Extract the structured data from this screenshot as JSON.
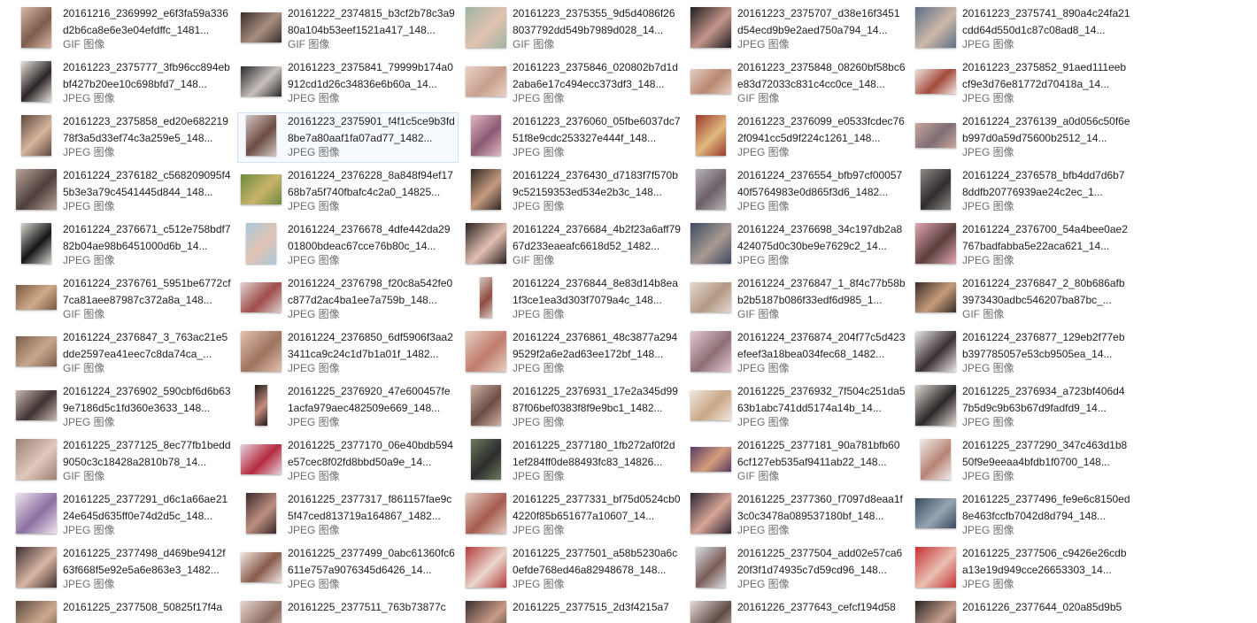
{
  "window": {
    "title": ""
  },
  "items": [
    {
      "name": "20161216_2369992_e6f3fa59a336d2b6ca8e6e3e04efdffc_1481...",
      "type": "GIF 图像",
      "thumb": {
        "colors": [
          "#d9b8a6",
          "#7c5b4c"
        ],
        "shape": "portrait"
      }
    },
    {
      "name": "20161222_2374815_b3cf2b78c3a980a104b53eef1521a417_148...",
      "type": "GIF 图像",
      "thumb": {
        "colors": [
          "#3b302c",
          "#a88e80"
        ],
        "shape": "landscape"
      }
    },
    {
      "name": "20161223_2375355_9d5d4086f268037792dd549b7989d028_14...",
      "type": "GIF 图像",
      "thumb": {
        "colors": [
          "#9fb3a4",
          "#e2c2b0"
        ],
        "shape": "square"
      }
    },
    {
      "name": "20161223_2375707_d38e16f3451d54ecd9b9e2aed750a794_14...",
      "type": "JPEG 图像",
      "thumb": {
        "colors": [
          "#1f1f1f",
          "#c4948a"
        ],
        "shape": "square"
      }
    },
    {
      "name": "20161223_2375741_890a4c24fa21cdd64d550d1c87c08ad8_14...",
      "type": "JPEG 图像",
      "thumb": {
        "colors": [
          "#5c7089",
          "#cdb7a6"
        ],
        "shape": "square"
      }
    },
    {
      "name": "20161223_2375777_3fb96cc894ebbf427b20ee10c698bfd7_148...",
      "type": "JPEG 图像",
      "thumb": {
        "colors": [
          "#e8e2dc",
          "#2b2626"
        ],
        "shape": "portrait"
      }
    },
    {
      "name": "20161223_2375841_79999b174a0912cd1d26c34836e6b60a_14...",
      "type": "JPEG 图像",
      "thumb": {
        "colors": [
          "#2c2a2c",
          "#c8c1bd"
        ],
        "shape": "landscape"
      }
    },
    {
      "name": "20161223_2375846_020802b7d1d2aba6e17c494ecc373df3_148...",
      "type": "JPEG 图像",
      "thumb": {
        "colors": [
          "#e9d2c6",
          "#c79f8c"
        ],
        "shape": "landscape"
      }
    },
    {
      "name": "20161223_2375848_08260bf58bc6e83d72033c831c4cc0ce_148...",
      "type": "GIF 图像",
      "thumb": {
        "colors": [
          "#e7cfc5",
          "#b7876f"
        ],
        "shape": "wide"
      }
    },
    {
      "name": "20161223_2375852_91aed111eebcf9e3d76e81772d70418a_14...",
      "type": "JPEG 图像",
      "thumb": {
        "colors": [
          "#efe4dc",
          "#a24a3c"
        ],
        "shape": "wide"
      }
    },
    {
      "name": "20161223_2375858_ed20e68221978f3a5d33ef74c3a259e5_148...",
      "type": "JPEG 图像",
      "thumb": {
        "colors": [
          "#5d4b3f",
          "#d6b49c"
        ],
        "shape": "portrait"
      }
    },
    {
      "name": "20161223_2375901_f4f1c5ce9b3fd8be7a80aaf1fa07ad77_1482...",
      "type": "JPEG 图像",
      "thumb": {
        "colors": [
          "#d2c6c2",
          "#6d4d43"
        ],
        "shape": "portrait"
      }
    },
    {
      "name": "20161223_2376060_05fbe6037dc751f8e9cdc253327e444f_148...",
      "type": "JPEG 图像",
      "thumb": {
        "colors": [
          "#e0b7c3",
          "#8b5a73"
        ],
        "shape": "portrait"
      }
    },
    {
      "name": "20161223_2376099_e0533fcdec762f0941cc5d9f224c1261_148...",
      "type": "JPEG 图像",
      "thumb": {
        "colors": [
          "#9b3a2e",
          "#e0b87d"
        ],
        "shape": "portrait"
      }
    },
    {
      "name": "20161224_2376139_a0d056c50f6eb997d0a59d75600b2512_14...",
      "type": "JPEG 图像",
      "thumb": {
        "colors": [
          "#c9a79f",
          "#7f6d73"
        ],
        "shape": "wide"
      }
    },
    {
      "name": "20161224_2376182_c568209095f45b3e3a79c4541445d844_148...",
      "type": "JPEG 图像",
      "thumb": {
        "colors": [
          "#b7a69b",
          "#4d3e3a"
        ],
        "shape": "square"
      }
    },
    {
      "name": "20161224_2376228_8a848f94ef1768b7a5f740fbafc4c2a0_14825...",
      "type": "JPEG 图像",
      "thumb": {
        "colors": [
          "#6d8a3f",
          "#c8b46a"
        ],
        "shape": "landscape"
      }
    },
    {
      "name": "20161224_2376430_d7183f7f570b9c52159353ed534e2b3c_148...",
      "type": "JPEG 图像",
      "thumb": {
        "colors": [
          "#2f2825",
          "#c79b80"
        ],
        "shape": "portrait"
      }
    },
    {
      "name": "20161224_2376554_bfb97cf0005740f5764983e0d865f3d6_1482...",
      "type": "JPEG 图像",
      "thumb": {
        "colors": [
          "#b8b3b8",
          "#6c5f67"
        ],
        "shape": "portrait"
      }
    },
    {
      "name": "20161224_2376578_bfb4dd7d6b78ddfb20776939ae24c2ec_1...",
      "type": "JPEG 图像",
      "thumb": {
        "colors": [
          "#8d8a87",
          "#2f2c2c"
        ],
        "shape": "portrait"
      }
    },
    {
      "name": "20161224_2376671_c512e758bdf782b04ae98b6451000d6b_14...",
      "type": "JPEG 图像",
      "thumb": {
        "colors": [
          "#d9d5d0",
          "#151515"
        ],
        "shape": "portrait"
      }
    },
    {
      "name": "20161224_2376678_4dfe442da2901800bdeac67cce76b80c_14...",
      "type": "JPEG 图像",
      "thumb": {
        "colors": [
          "#a9c8da",
          "#e2c4b4"
        ],
        "shape": "portrait"
      }
    },
    {
      "name": "20161224_2376684_4b2f23a6aff7967d233eaeafc6618d52_1482...",
      "type": "GIF 图像",
      "thumb": {
        "colors": [
          "#2a2220",
          "#e2bfb2"
        ],
        "shape": "square"
      }
    },
    {
      "name": "20161224_2376698_34c197db2a8424075d0c30be9e7629c2_14...",
      "type": "JPEG 图像",
      "thumb": {
        "colors": [
          "#3f4b62",
          "#a89a92"
        ],
        "shape": "square"
      }
    },
    {
      "name": "20161224_2376700_54a4bee0ae2767badfabba5e22aca621_14...",
      "type": "JPEG 图像",
      "thumb": {
        "colors": [
          "#e2a6b4",
          "#5b3f3c"
        ],
        "shape": "square"
      }
    },
    {
      "name": "20161224_2376761_5951be6772cf7ca81aee87987c372a8a_148...",
      "type": "GIF 图像",
      "thumb": {
        "colors": [
          "#7a5a43",
          "#d0aa8a"
        ],
        "shape": "wide"
      }
    },
    {
      "name": "20161224_2376798_f20c8a542fe0c877d2ac4ba1ee7a759b_148...",
      "type": "JPEG 图像",
      "thumb": {
        "colors": [
          "#ded2cf",
          "#a04c4a"
        ],
        "shape": "landscape"
      }
    },
    {
      "name": "20161224_2376844_8e83d14b8ea1f3ce1ea3d303f7079a4c_148...",
      "type": "JPEG 图像",
      "thumb": {
        "colors": [
          "#d7c6c0",
          "#8e4b43"
        ],
        "shape": "thin"
      }
    },
    {
      "name": "20161224_2376847_1_8f4c77b58bb2b5187b086f33edf6d985_1...",
      "type": "GIF 图像",
      "thumb": {
        "colors": [
          "#e4d8cf",
          "#b39984"
        ],
        "shape": "landscape"
      }
    },
    {
      "name": "20161224_2376847_2_80b686afb3973430adbc546207ba87bc_...",
      "type": "GIF 图像",
      "thumb": {
        "colors": [
          "#3a2c29",
          "#c59c7b"
        ],
        "shape": "landscape"
      }
    },
    {
      "name": "20161224_2376847_3_763ac21e5dde2597ea41eec7c8da74ca_...",
      "type": "GIF 图像",
      "thumb": {
        "colors": [
          "#7b5f4c",
          "#c9a78d"
        ],
        "shape": "landscape"
      }
    },
    {
      "name": "20161224_2376850_6df5906f3aa23411ca9c24c1d7b1a01f_1482...",
      "type": "JPEG 图像",
      "thumb": {
        "colors": [
          "#e3c2ae",
          "#9d7460"
        ],
        "shape": "square"
      }
    },
    {
      "name": "20161224_2376861_48c3877a2949529f2a6e2ad63ee172bf_148...",
      "type": "JPEG 图像",
      "thumb": {
        "colors": [
          "#e7cfc3",
          "#c07c6c"
        ],
        "shape": "square"
      }
    },
    {
      "name": "20161224_2376874_204f77c5d423efeef3a18bea034fec68_1482...",
      "type": "JPEG 图像",
      "thumb": {
        "colors": [
          "#e2c8d2",
          "#8f6f76"
        ],
        "shape": "square"
      }
    },
    {
      "name": "20161224_2376877_129eb2f77ebb397785057e53cb9505ea_14...",
      "type": "JPEG 图像",
      "thumb": {
        "colors": [
          "#ebe8e6",
          "#3a3032"
        ],
        "shape": "square"
      }
    },
    {
      "name": "20161224_2376902_590cbf6d6b639e7186d5c1fd360e3633_148...",
      "type": "JPEG 图像",
      "thumb": {
        "colors": [
          "#c8b8b0",
          "#403232"
        ],
        "shape": "landscape"
      }
    },
    {
      "name": "20161225_2376920_47e600457fe1acfa979aec482509e669_148...",
      "type": "JPEG 图像",
      "thumb": {
        "colors": [
          "#211a1a",
          "#c48d7c"
        ],
        "shape": "thin"
      }
    },
    {
      "name": "20161225_2376931_17e2a345d9987f06bef0383f8f9e9bc1_1482...",
      "type": "JPEG 图像",
      "thumb": {
        "colors": [
          "#cfb1a4",
          "#6a4e45"
        ],
        "shape": "portrait"
      }
    },
    {
      "name": "20161225_2376932_7f504c251da563b1abc741dd5174a14b_14...",
      "type": "JPEG 图像",
      "thumb": {
        "colors": [
          "#efe6dd",
          "#c9a886"
        ],
        "shape": "landscape"
      }
    },
    {
      "name": "20161225_2376934_a723bf406d47b5d9c9b63b67d9fadfd9_14...",
      "type": "JPEG 图像",
      "thumb": {
        "colors": [
          "#ded9d4",
          "#2c2727"
        ],
        "shape": "square"
      }
    },
    {
      "name": "20161225_2377125_8ec77fb1bedd9050c3c18428a2810b78_14...",
      "type": "GIF 图像",
      "thumb": {
        "colors": [
          "#9a8176",
          "#e1c8bc"
        ],
        "shape": "square"
      }
    },
    {
      "name": "20161225_2377170_06e40bdb594e57cec8f02fd8bbd50a9e_14...",
      "type": "JPEG 图像",
      "thumb": {
        "colors": [
          "#e6d3dc",
          "#b42a3f"
        ],
        "shape": "landscape"
      }
    },
    {
      "name": "20161225_2377180_1fb272af0f2d1ef284ff0de88493fc83_14826...",
      "type": "JPEG 图像",
      "thumb": {
        "colors": [
          "#6c7a5d",
          "#2c2c2c"
        ],
        "shape": "portrait"
      }
    },
    {
      "name": "20161225_2377181_90a781bfb606cf127eb535af9411ab22_148...",
      "type": "GIF 图像",
      "thumb": {
        "colors": [
          "#593b63",
          "#d49d7b"
        ],
        "shape": "wide"
      }
    },
    {
      "name": "20161225_2377290_347c463d1b850f9e9eeaa4bfdb1f0700_148...",
      "type": "JPEG 图像",
      "thumb": {
        "colors": [
          "#f1ebe8",
          "#b88376"
        ],
        "shape": "portrait"
      }
    },
    {
      "name": "20161225_2377291_d6c1a66ae2124e645d635ff0e74d2d5c_148...",
      "type": "JPEG 图像",
      "thumb": {
        "colors": [
          "#efe5ee",
          "#8c6fa1"
        ],
        "shape": "square"
      }
    },
    {
      "name": "20161225_2377317_f861157fae9c5f47ced813719a164867_1482...",
      "type": "JPEG 图像",
      "thumb": {
        "colors": [
          "#3b2a2a",
          "#bd8f80"
        ],
        "shape": "portrait"
      }
    },
    {
      "name": "20161225_2377331_bf75d0524cb04220f85b651677a10607_14...",
      "type": "JPEG 图像",
      "thumb": {
        "colors": [
          "#e6d0c6",
          "#a55c4e"
        ],
        "shape": "square"
      }
    },
    {
      "name": "20161225_2377360_f7097d8eaa1f3c0c3478a089537180bf_148...",
      "type": "JPEG 图像",
      "thumb": {
        "colors": [
          "#2c2536",
          "#d7a595"
        ],
        "shape": "square"
      }
    },
    {
      "name": "20161225_2377496_fe9e6c8150ed8e463fccfb7042d8d794_148...",
      "type": "JPEG 图像",
      "thumb": {
        "colors": [
          "#3c4a5f",
          "#96a5b3"
        ],
        "shape": "landscape"
      }
    },
    {
      "name": "20161225_2377498_d469be9412f63f668f5e92e5a6e863e3_1482...",
      "type": "JPEG 图像",
      "thumb": {
        "colors": [
          "#3e2f2f",
          "#d8b6a4"
        ],
        "shape": "square"
      }
    },
    {
      "name": "20161225_2377499_0abc61360fc6611e757a9076345d6426_14...",
      "type": "JPEG 图像",
      "thumb": {
        "colors": [
          "#efe6e0",
          "#8a5b4c"
        ],
        "shape": "landscape"
      }
    },
    {
      "name": "20161225_2377501_a58b5230a6c0efde768ed46a82948678_148...",
      "type": "JPEG 图像",
      "thumb": {
        "colors": [
          "#b23b3b",
          "#ead7cc"
        ],
        "shape": "square"
      }
    },
    {
      "name": "20161225_2377504_add02e57ca620f3f1d74935c7d59cd96_148...",
      "type": "JPEG 图像",
      "thumb": {
        "colors": [
          "#d9dde2",
          "#7b5d58"
        ],
        "shape": "portrait"
      }
    },
    {
      "name": "20161225_2377506_c9426e26cdba13e19d949cce26653303_14...",
      "type": "JPEG 图像",
      "thumb": {
        "colors": [
          "#c82f34",
          "#e9c0b2"
        ],
        "shape": "square"
      }
    },
    {
      "name": "20161225_2377508_50825f17f4a",
      "type": "",
      "thumb": {
        "colors": [
          "#5a4a3e",
          "#cfa98f"
        ],
        "shape": "square"
      }
    },
    {
      "name": "20161225_2377511_763b73877c",
      "type": "",
      "thumb": {
        "colors": [
          "#e6d6cf",
          "#8b6a60"
        ],
        "shape": "square"
      }
    },
    {
      "name": "20161225_2377515_2d3f4215a7",
      "type": "",
      "thumb": {
        "colors": [
          "#3a2f2d",
          "#c89b86"
        ],
        "shape": "square"
      }
    },
    {
      "name": "20161226_2377643_cefcf194d58",
      "type": "",
      "thumb": {
        "colors": [
          "#e7dcd8",
          "#5f4a45"
        ],
        "shape": "square"
      }
    },
    {
      "name": "20161226_2377644_020a85d9b5",
      "type": "",
      "thumb": {
        "colors": [
          "#2a2424",
          "#c7a08d"
        ],
        "shape": "square"
      }
    }
  ],
  "selected_index": 11
}
